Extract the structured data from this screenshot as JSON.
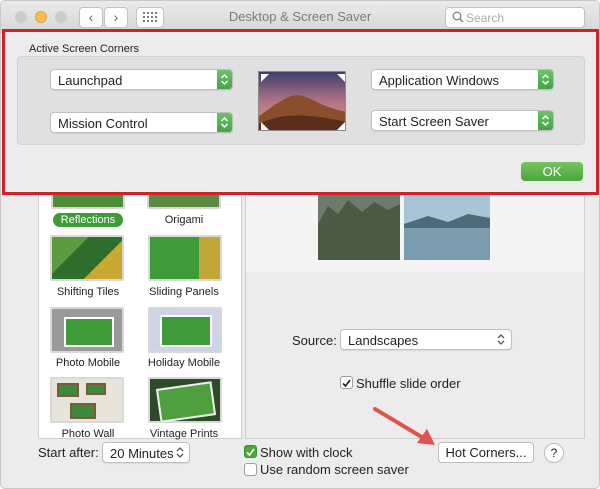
{
  "window": {
    "title": "Desktop & Screen Saver",
    "back_glyph": "‹",
    "forward_glyph": "›",
    "search_placeholder": "Search"
  },
  "hot_corners_sheet": {
    "title": "Active Screen Corners",
    "top_left": "Launchpad",
    "bottom_left": "Mission Control",
    "top_right": "Application Windows",
    "bottom_right": "Start Screen Saver",
    "ok_label": "OK"
  },
  "screen_savers": [
    {
      "label": "Reflections",
      "selected": true
    },
    {
      "label": "Origami"
    },
    {
      "label": "Shifting Tiles"
    },
    {
      "label": "Sliding Panels"
    },
    {
      "label": "Photo Mobile"
    },
    {
      "label": "Holiday Mobile"
    },
    {
      "label": "Photo Wall"
    },
    {
      "label": "Vintage Prints"
    }
  ],
  "preview": {
    "source_label": "Source:",
    "source_value": "Landscapes",
    "shuffle_label": "Shuffle slide order",
    "shuffle_checked": true
  },
  "bottom": {
    "start_after_label": "Start after:",
    "start_after_value": "20 Minutes",
    "show_clock_label": "Show with clock",
    "show_clock_checked": true,
    "random_label": "Use random screen saver",
    "random_checked": false,
    "hot_corners_label": "Hot Corners...",
    "help_label": "?"
  },
  "colors": {
    "highlight_border": "#d02227",
    "accent_green": "#4ea63d",
    "annotation_arrow": "#e0524a"
  }
}
